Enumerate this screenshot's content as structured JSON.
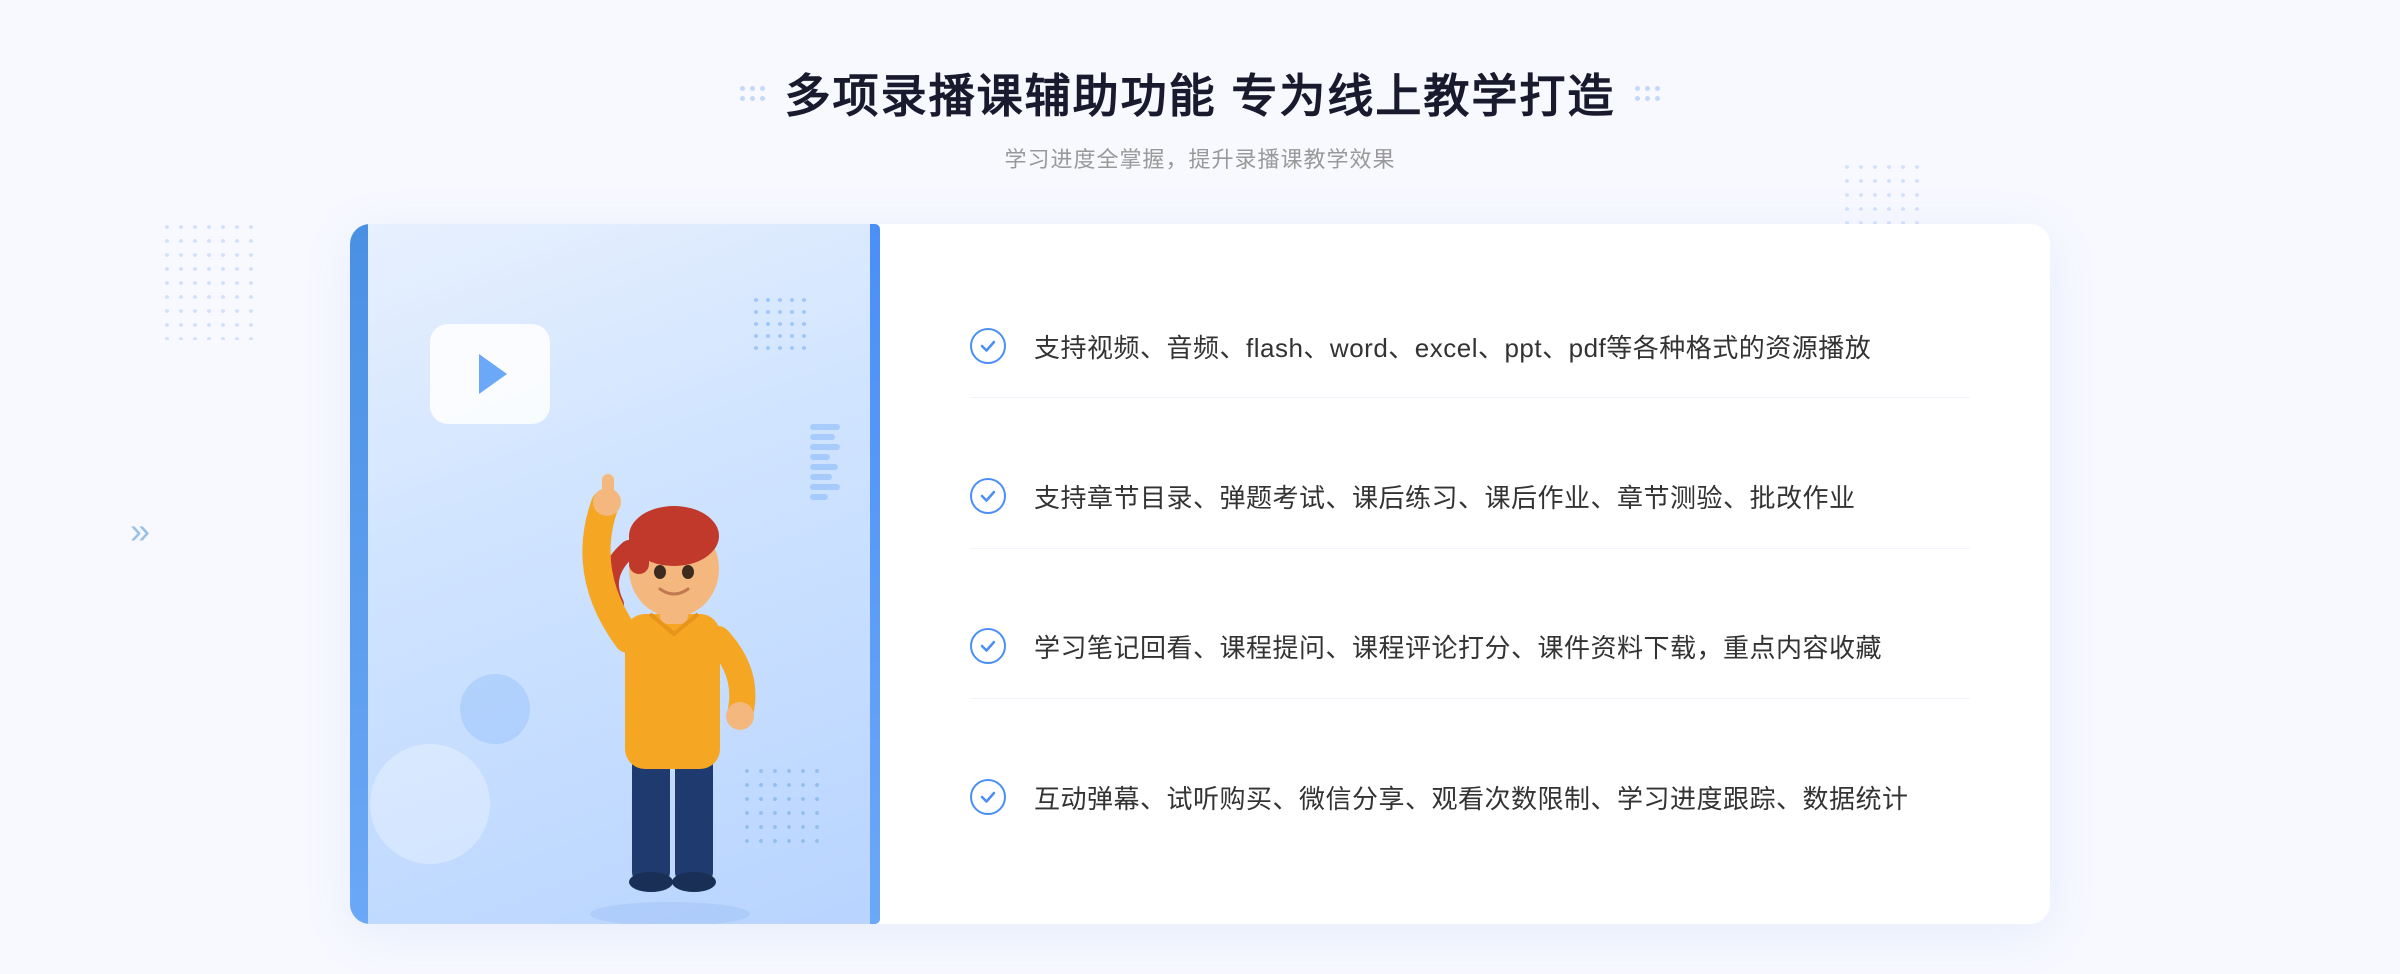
{
  "page": {
    "background": "#f8f9ff"
  },
  "header": {
    "title": "多项录播课辅助功能 专为线上教学打造",
    "subtitle": "学习进度全掌握，提升录播课教学效果",
    "dots_decoration_left": "grid-dots",
    "dots_decoration_right": "grid-dots"
  },
  "features": [
    {
      "id": 1,
      "text": "支持视频、音频、flash、word、excel、ppt、pdf等各种格式的资源播放",
      "icon": "check-circle-icon"
    },
    {
      "id": 2,
      "text": "支持章节目录、弹题考试、课后练习、课后作业、章节测验、批改作业",
      "icon": "check-circle-icon"
    },
    {
      "id": 3,
      "text": "学习笔记回看、课程提问、课程评论打分、课件资料下载，重点内容收藏",
      "icon": "check-circle-icon"
    },
    {
      "id": 4,
      "text": "互动弹幕、试听购买、微信分享、观看次数限制、学习进度跟踪、数据统计",
      "icon": "check-circle-icon"
    }
  ],
  "illustration": {
    "play_button": "▶",
    "chevron": "»"
  }
}
